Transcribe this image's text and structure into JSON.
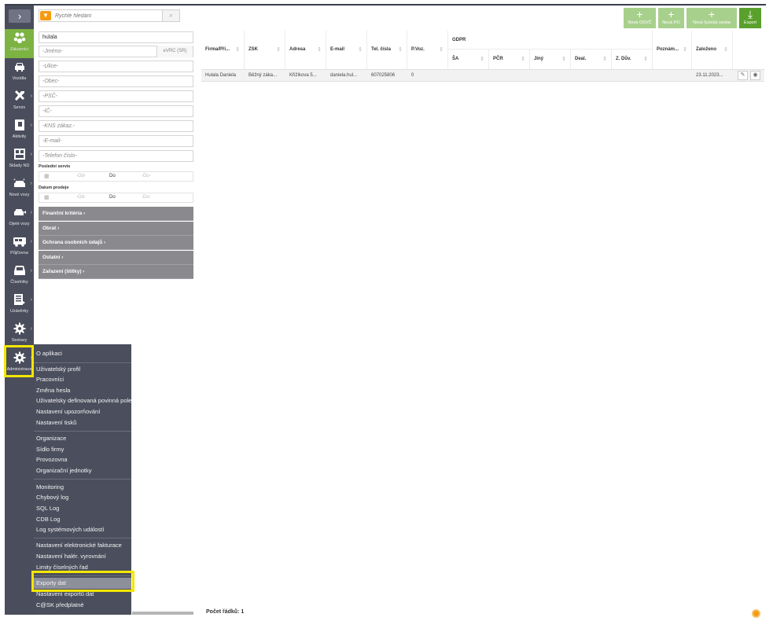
{
  "nav": {
    "toggle": "›",
    "items": [
      {
        "label": "Zákazníci",
        "icon": "people-icon",
        "active": true
      },
      {
        "label": "Vozidla",
        "icon": "car-icon"
      },
      {
        "label": "Servis",
        "icon": "tools-icon"
      },
      {
        "label": "Aktivity",
        "icon": "notebook-icon"
      },
      {
        "label": "Sklady ND",
        "icon": "warehouse-icon"
      },
      {
        "label": "Nové vozy",
        "icon": "new-car-icon"
      },
      {
        "label": "Ojeté vozy",
        "icon": "used-car-icon"
      },
      {
        "label": "Půjčovna",
        "icon": "rental-bus-icon"
      },
      {
        "label": "Číselníky",
        "icon": "tray-icon"
      },
      {
        "label": "Uzávěrky",
        "icon": "ledger-icon"
      },
      {
        "label": "Sestavy",
        "icon": "gear-icon"
      },
      {
        "label": "Administrace",
        "icon": "gear-icon"
      }
    ]
  },
  "search": {
    "placeholder": "Rychlé hledání"
  },
  "filters": {
    "surname": "hulala",
    "first_name": "-Jméno-",
    "evrc": "eVRC (SR)",
    "street": "-Ulice-",
    "city": "-Obec-",
    "zip": "-PSČ-",
    "ico": "-IČ-",
    "kns": "-KNS zákaz.-",
    "email": "-E-mail-",
    "phone": "-Telefon číslo-",
    "last_service_label": "Poslední servis",
    "sale_date_label": "Datum prodeje",
    "from": "-Od-",
    "to": "Do",
    "to_value": "-Do-"
  },
  "accordions": [
    "Finanční kritéria ›",
    "Obrat ›",
    "Ochrana osobních údajů ›",
    "Ostatní ›",
    "Zařazení (štítky) ›"
  ],
  "toolbar": {
    "new_osvc": "Nová OSVČ",
    "new_po": "Nová PO",
    "new_person": "Nová fyzická osoba",
    "export": "Export"
  },
  "table": {
    "columns": [
      "Firma/Pří...",
      "ZSK",
      "Adresa",
      "E-mail",
      "Tel. čísla",
      "P.Voz.",
      "GDPR",
      "Poznám...",
      "Založeno"
    ],
    "gdpr_subcolumns": [
      "ŠA",
      "PČR",
      "Jiný",
      "Deal.",
      "Z. Dův."
    ],
    "rows": [
      {
        "firma": "Hulala Daniela",
        "zsk": "Běžný záka...",
        "adresa": "Křižíkova 5...",
        "email": "daniela.hul...",
        "tel": "607025806",
        "pvoz": "0",
        "zalozeno": "23.11.2023..."
      }
    ],
    "row_count": "Počet řádků: 1"
  },
  "admin_menu": {
    "group1": [
      "O aplikaci"
    ],
    "group2": [
      "Uživatelský profil",
      "Pracovníci",
      "Změna hesla",
      "Uživatelsky definovaná povinná pole",
      "Nastavení upozorňování",
      "Nastavení tisků"
    ],
    "group3": [
      "Organizace",
      "Sídlo firmy",
      "Provozovna",
      "Organizační jednotky"
    ],
    "group4": [
      "Monitoring",
      "Chybový log",
      "SQL Log",
      "CDB Log",
      "Log systémových událostí"
    ],
    "group5": [
      "Nastavení elektronické fakturace",
      "Nastavení halér. vyrovnání",
      "Limity číselných řad"
    ],
    "group6": [
      "Exporty dat",
      "Nastavení exportů dat",
      "C@SK předplatné"
    ]
  },
  "colors": {
    "nav_bg": "#4a4e5c",
    "active_green": "#7cb342",
    "highlight_yellow": "#f3e600",
    "button_green_light": "#a8d08d",
    "button_green_dark": "#5aa02c",
    "filter_orange": "#f39c12"
  }
}
